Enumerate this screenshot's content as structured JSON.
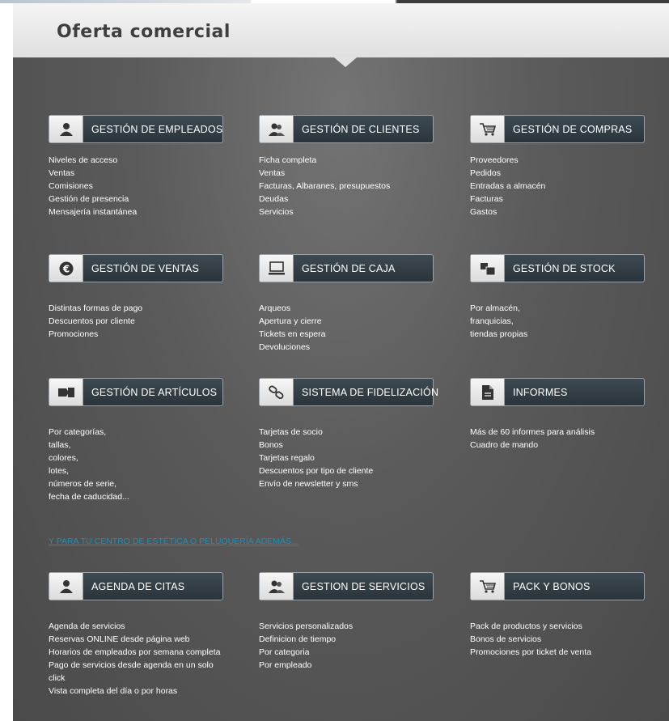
{
  "header": {
    "title": "Oferta comercial"
  },
  "rows": [
    [
      {
        "icon": "person-icon",
        "label": "GESTIÓN DE EMPLEADOS",
        "items": [
          "Niveles de acceso",
          "Ventas",
          "Comisiones",
          "Gestión de presencia",
          "Mensajería instantánea"
        ]
      },
      {
        "icon": "people-icon",
        "label": "GESTIÓN DE CLIENTES",
        "items": [
          "Ficha completa",
          "Ventas",
          "Facturas, Albaranes, presupuestos",
          "Deudas",
          "Servicios"
        ]
      },
      {
        "icon": "cart-icon",
        "label": "GESTIÓN DE COMPRAS",
        "items": [
          "Proveedores",
          "Pedidos",
          "Entradas a almacén",
          "Facturas",
          "Gastos"
        ]
      }
    ],
    [
      {
        "icon": "euro-icon",
        "label": "GESTIÓN DE VENTAS",
        "items": [
          "Distintas formas de pago",
          "Descuentos por cliente",
          "Promociones"
        ]
      },
      {
        "icon": "monitor-icon",
        "label": "GESTIÓN DE CAJA",
        "items": [
          "Arqueos",
          "Apertura y cierre",
          "Tickets en espera",
          "Devoluciones"
        ]
      },
      {
        "icon": "boxes-icon",
        "label": "GESTIÓN DE STOCK",
        "items": [
          "Por almacén,",
          "franquicias,",
          "tiendas propias"
        ]
      }
    ],
    [
      {
        "icon": "tag-icon",
        "label": "GESTIÓN DE ARTÍCULOS",
        "items": [
          "Por categorías,",
          "tallas,",
          "colores,",
          "lotes,",
          "números de serie,",
          "fecha de caducidad..."
        ]
      },
      {
        "icon": "link-icon",
        "label": "SISTEMA DE FIDELIZACIÓN",
        "items": [
          "Tarjetas de socio",
          "Bonos",
          "Tarjetas regalo",
          "Descuentos por tipo de cliente",
          "Envío de newsletter y sms"
        ]
      },
      {
        "icon": "document-icon",
        "label": "INFORMES",
        "items": [
          "Más de 60 informes para análisis",
          "Cuadro de mando"
        ]
      }
    ]
  ],
  "section_note": "Y PARA TU CENTRO DE ESTÉTICA O PELUQUERÍA ADEMÁS...",
  "extra_row": [
    {
      "icon": "person-icon",
      "label": "AGENDA DE CITAS",
      "items": [
        "Agenda de servicios",
        "Reservas ONLINE desde página web",
        "Horarios de empleados por semana completa",
        "Pago de servicios desde agenda en un solo click",
        "Vista completa del día o por horas"
      ]
    },
    {
      "icon": "people-icon",
      "label": "GESTION DE SERVICIOS",
      "items": [
        "Servicios personalizados",
        "Definicion de tiempo",
        "Por categoria",
        "Por empleado"
      ]
    },
    {
      "icon": "cart-icon",
      "label": "PACK Y BONOS",
      "items": [
        "Pack de productos y servicios",
        "Bonos de servicios",
        "Promociones por ticket de venta"
      ]
    }
  ]
}
